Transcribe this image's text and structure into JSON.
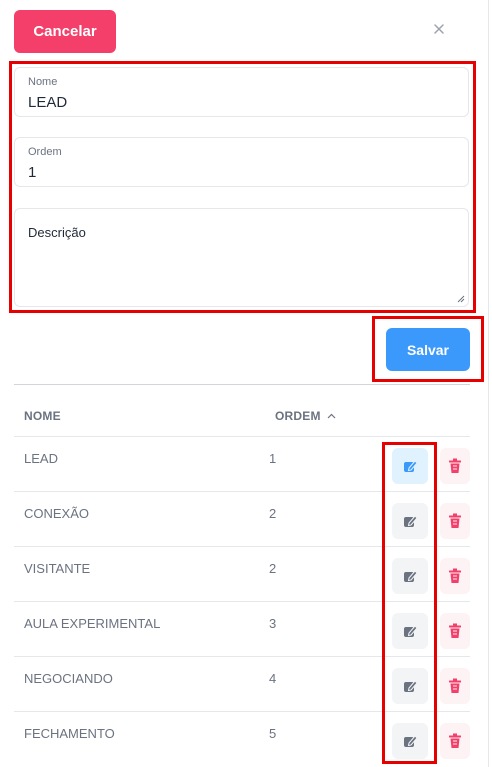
{
  "header": {
    "cancel_label": "Cancelar",
    "close_icon": "close-icon"
  },
  "form": {
    "nome": {
      "label": "Nome",
      "value": "LEAD"
    },
    "ordem": {
      "label": "Ordem",
      "value": "1"
    },
    "descricao": {
      "placeholder": "Descrição",
      "value": ""
    },
    "save_label": "Salvar"
  },
  "table": {
    "columns": {
      "nome": "NOME",
      "ordem": "ORDEM"
    },
    "sort_icon": "chevron-up-icon",
    "rows": [
      {
        "nome": "LEAD",
        "ordem": "1",
        "editing": true
      },
      {
        "nome": "CONEXÃO",
        "ordem": "2",
        "editing": false
      },
      {
        "nome": "VISITANTE",
        "ordem": "2",
        "editing": false
      },
      {
        "nome": "AULA EXPERIMENTAL",
        "ordem": "3",
        "editing": false
      },
      {
        "nome": "NEGOCIANDO",
        "ordem": "4",
        "editing": false
      },
      {
        "nome": "FECHAMENTO",
        "ordem": "5",
        "editing": false
      }
    ],
    "edit_icon": "edit-icon",
    "delete_icon": "trash-icon"
  },
  "colors": {
    "cancel": "#f43f6a",
    "save": "#3b99fc",
    "highlight": "#e60000",
    "edit_active": "#3b99fc",
    "edit_idle": "#6b7280",
    "delete": "#f43f6a"
  }
}
